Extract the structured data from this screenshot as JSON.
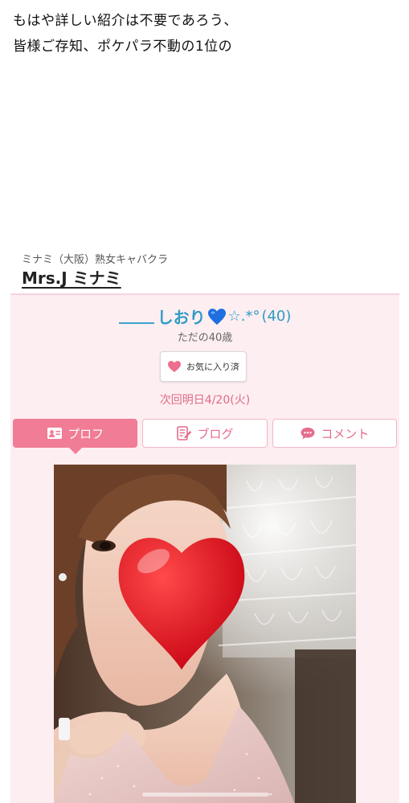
{
  "intro": {
    "line1": "もはや詳しい紹介は不要であろう、",
    "line2": "皆様ご存知、ポケパラ不動の1位の"
  },
  "shop": {
    "subtitle": "ミナミ（大阪）熟女キャバクラ",
    "name": "Mrs.J ミナミ"
  },
  "profile": {
    "name": "しおり",
    "stars": "☆.*°",
    "age": "(40)",
    "catchphrase": "ただの40歳",
    "favorite_label": "お気に入り済",
    "next_attendance": "次回明日4/20(火)"
  },
  "tabs": [
    {
      "label": "プロフ",
      "icon": "profile-card-icon",
      "active": true
    },
    {
      "label": "ブログ",
      "icon": "blog-edit-icon",
      "active": false
    },
    {
      "label": "コメント",
      "icon": "comment-bubble-icon",
      "active": false
    }
  ],
  "colors": {
    "accent_pink": "#f07c96",
    "name_blue": "#2f9cc5",
    "card_bg": "#fdeef1",
    "date_pink": "#e06a86"
  }
}
